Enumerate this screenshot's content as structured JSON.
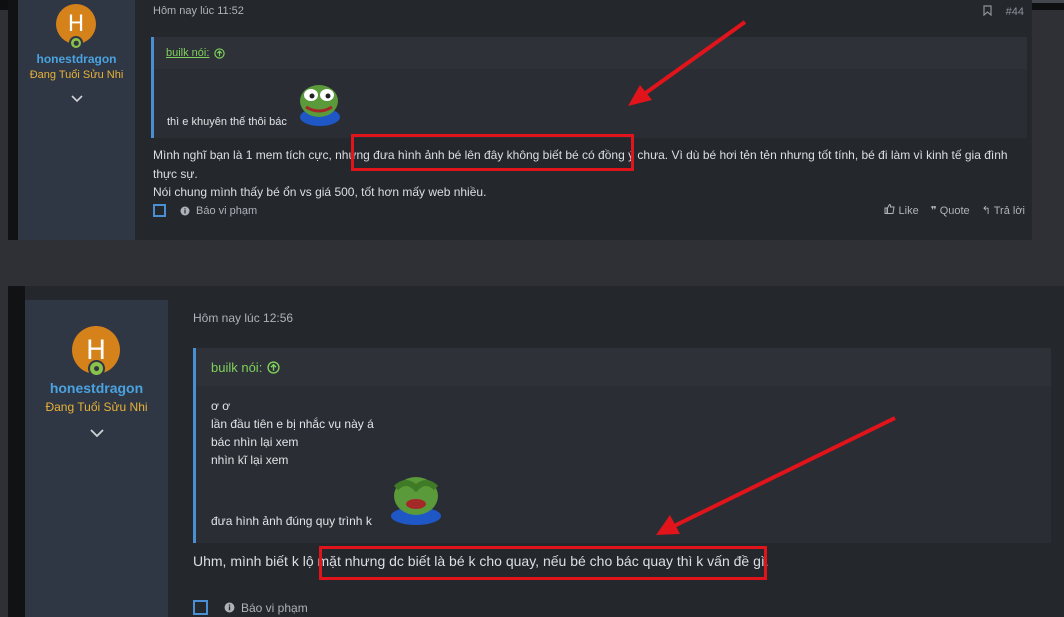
{
  "posts": [
    {
      "username": "honestdragon",
      "user_title": "Đang Tuổi Sửu Nhi",
      "avatar_letter": "H",
      "time": "Hôm nay lúc 11:52",
      "post_number": "#44",
      "quote_author": "builk nói:",
      "quote_lines": [
        "thì e khuyên thế thôi bác"
      ],
      "body_lines": [
        "Mình nghĩ bạn là 1 mem tích cực, nhưng đưa hình ảnh bé lên đây không biết bé có đồng ý chưa. Vì dù bé hơi tẻn tẻn nhưng tốt tính, bé đi làm vì kinh tế gia đình thực sự.",
        "Nói chung mình thấy bé ổn vs giá 500, tốt hơn mấy web nhiều."
      ],
      "report_label": "Báo vi phạm",
      "like_label": "Like",
      "quote_label": "Quote",
      "reply_label": "Trả lời"
    },
    {
      "username": "honestdragon",
      "user_title": "Đang Tuổi Sửu Nhi",
      "avatar_letter": "H",
      "time": "Hôm nay lúc 12:56",
      "quote_author": "builk nói:",
      "quote_lines": [
        "ơ ơ",
        "lần đầu tiên e bị nhắc vụ này á",
        "bác nhìn lại xem",
        "nhìn kĩ lại xem",
        "đưa hình ảnh đúng quy trình k"
      ],
      "body": "Uhm, mình biết k lộ mặt nhưng dc biết là bé k cho quay, nếu bé cho bác quay thì k vấn đề gì.",
      "report_label": "Báo vi phạm"
    }
  ],
  "colors": {
    "background": "#2e3035",
    "post": "#24272c",
    "user_panel": "#2f3744",
    "username": "#4aa3e0",
    "user_title": "#e8b237",
    "quote_head": "#7fd15d",
    "annotation_red": "#e0141a"
  },
  "icons": [
    "chevron-down-icon",
    "up-circle-icon",
    "bookmark-icon",
    "checkbox-icon",
    "info-icon",
    "like-icon",
    "quote-icon",
    "reply-icon",
    "pepe-emoji",
    "arrow-annotation"
  ]
}
